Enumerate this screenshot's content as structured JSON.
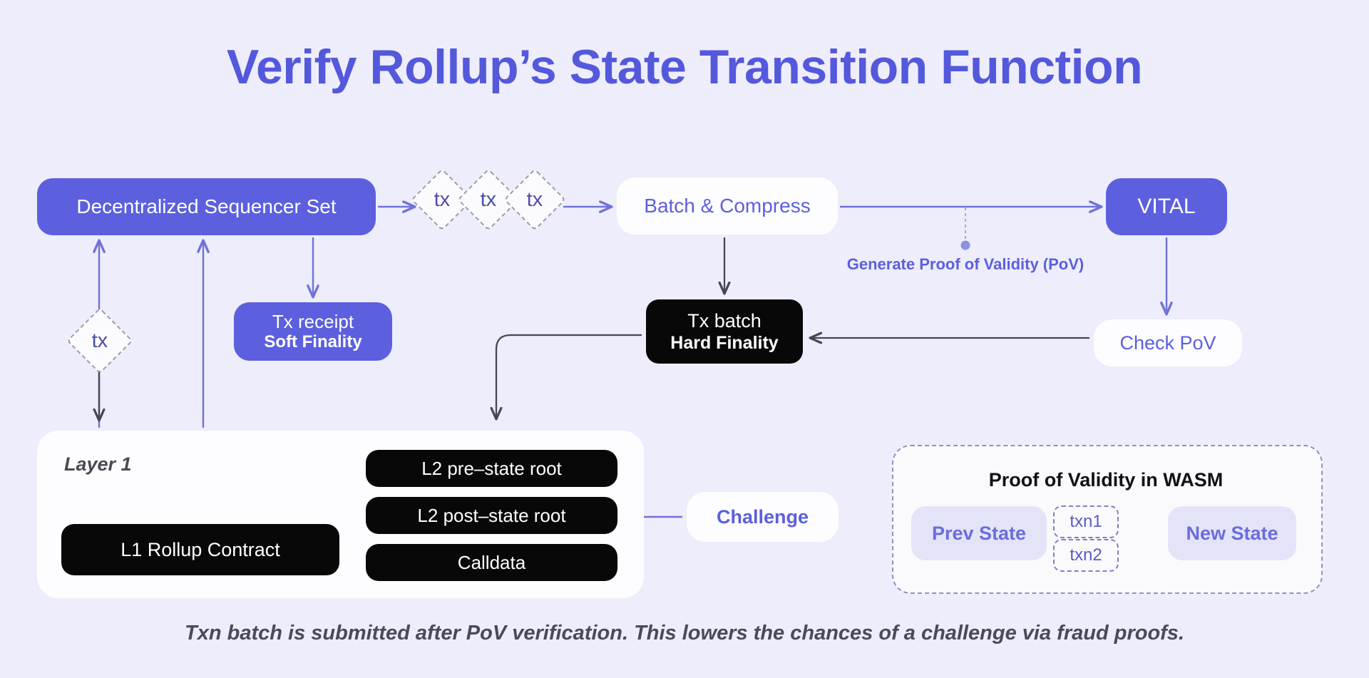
{
  "page": {
    "title": "Verify Rollup’s State Transition Function",
    "caption": "Txn batch is submitted after PoV verification. This lowers the chances of a challenge via fraud proofs.",
    "background_color": "#eeedfb",
    "accent_color": "#5c5fde",
    "title_color": "#5458db"
  },
  "flow": {
    "sequencer_set": {
      "label": "Decentralized Sequencer Set",
      "style": "purple"
    },
    "tx_diamonds": [
      {
        "label": "tx"
      },
      {
        "label": "tx"
      },
      {
        "label": "tx"
      }
    ],
    "batch_compress": {
      "label": "Batch & Compress",
      "style": "white"
    },
    "vital": {
      "label": "VITAL",
      "style": "purple"
    },
    "pov_annotation": {
      "label": "Generate Proof of Validity (PoV)"
    },
    "tx_receipt": {
      "line1": "Tx receipt",
      "line2": "Soft Finality",
      "style": "purple"
    },
    "tx_batch": {
      "line1": "Tx batch",
      "line2": "Hard Finality",
      "style": "black"
    },
    "check_pov": {
      "label": "Check PoV",
      "style": "white"
    },
    "left_tx_diamond": {
      "label": "tx"
    },
    "challenge": {
      "label": "Challenge",
      "style": "white"
    }
  },
  "layer1": {
    "label": "Layer 1",
    "rollup_contract": {
      "label": "L1 Rollup Contract",
      "style": "black"
    },
    "items": [
      {
        "label": "L2 pre–state root",
        "style": "black"
      },
      {
        "label": "L2 post–state root",
        "style": "black"
      },
      {
        "label": "Calldata",
        "style": "black"
      }
    ]
  },
  "wasm": {
    "title": "Proof of Validity in WASM",
    "prev_state": {
      "label": "Prev State"
    },
    "transactions": [
      {
        "label": "txn1"
      },
      {
        "label": "txn2"
      }
    ],
    "new_state": {
      "label": "New State"
    }
  }
}
